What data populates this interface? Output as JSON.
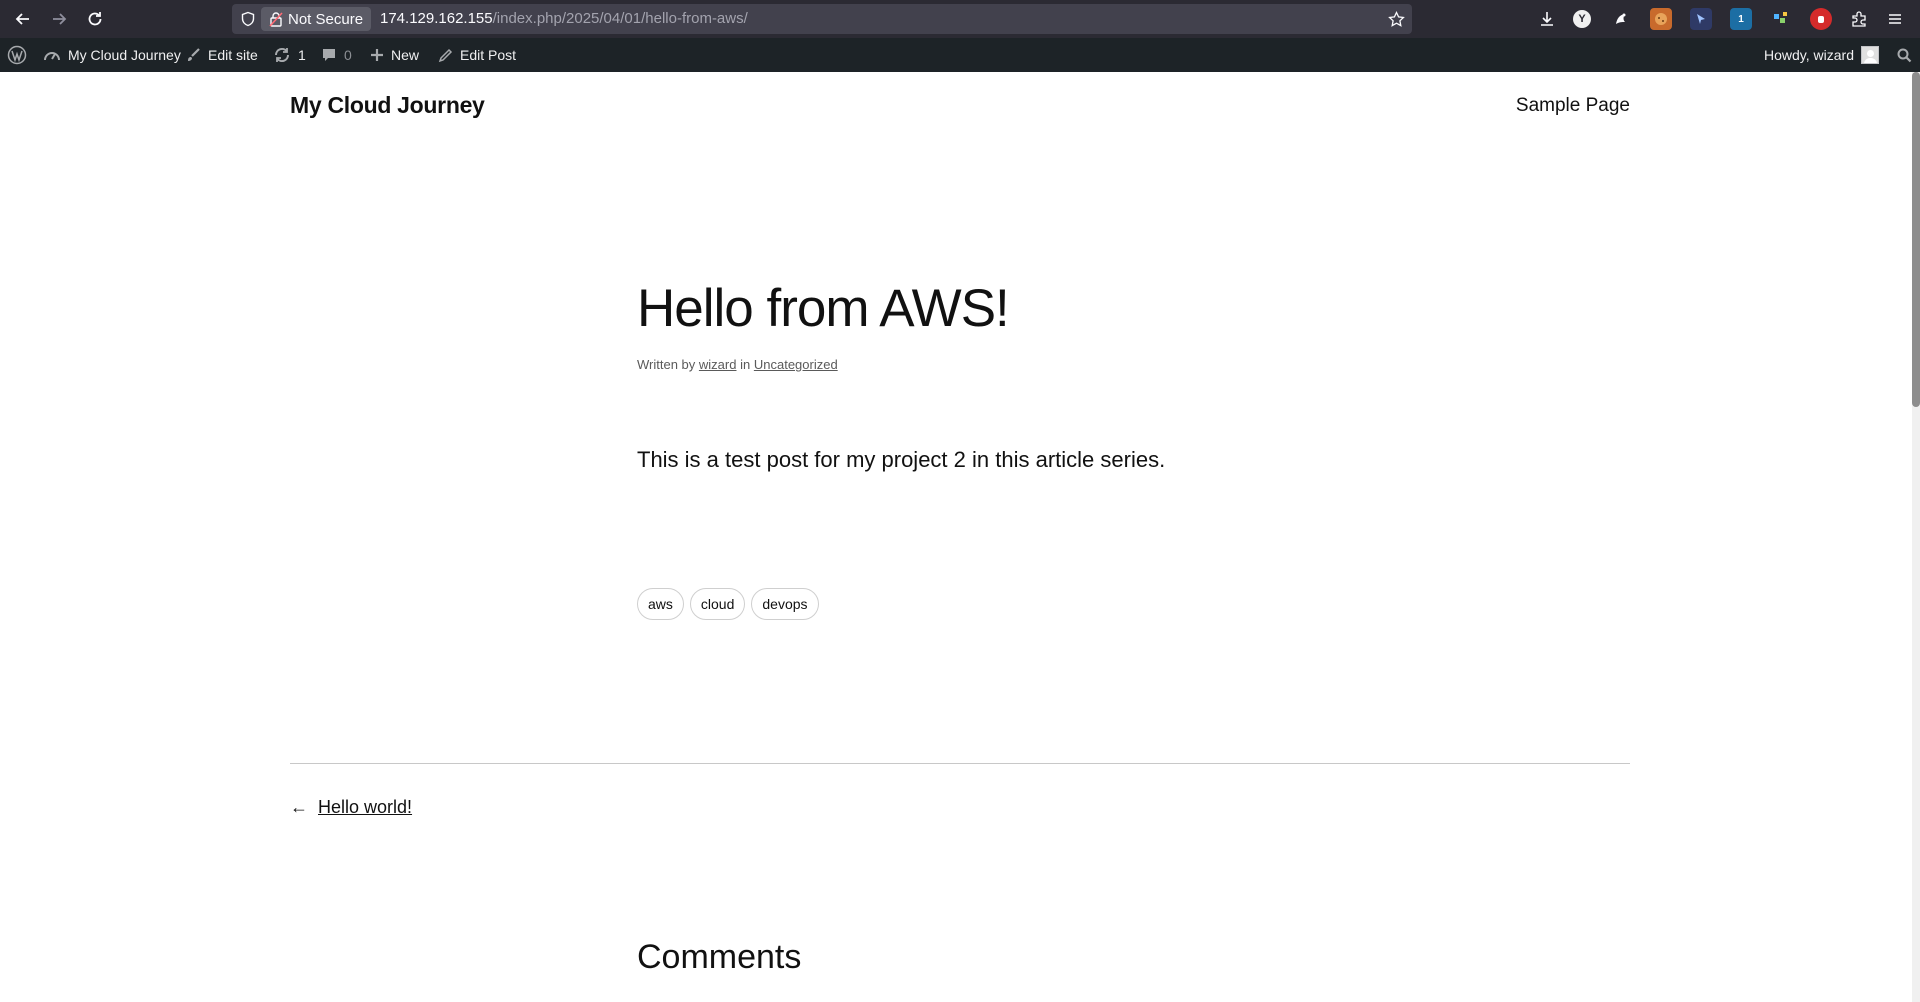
{
  "browser": {
    "security_label": "Not Secure",
    "url_host": "174.129.162.155",
    "url_path": "/index.php/2025/04/01/hello-from-aws/",
    "extension_badge": "1"
  },
  "admin_bar": {
    "site_name": "My Cloud Journey",
    "edit_site": "Edit site",
    "updates_count": "1",
    "comments_count": "0",
    "new_label": "New",
    "edit_post": "Edit Post",
    "howdy": "Howdy, wizard"
  },
  "site": {
    "title": "My Cloud Journey",
    "nav_link": "Sample Page"
  },
  "post": {
    "title": "Hello from AWS!",
    "byline_written_by": "Written by",
    "author": "wizard",
    "byline_in": "in",
    "category": "Uncategorized",
    "body": "This is a test post for my project 2 in this article series.",
    "tags": [
      "aws",
      "cloud",
      "devops"
    ],
    "prev_arrow": "←",
    "prev_post": "Hello world!",
    "comments_heading": "Comments"
  },
  "colors": {
    "browser_bg": "#2b2a33",
    "urlbar_bg": "#42414d",
    "admin_bar_bg": "#1d2327",
    "text": "#111111"
  }
}
